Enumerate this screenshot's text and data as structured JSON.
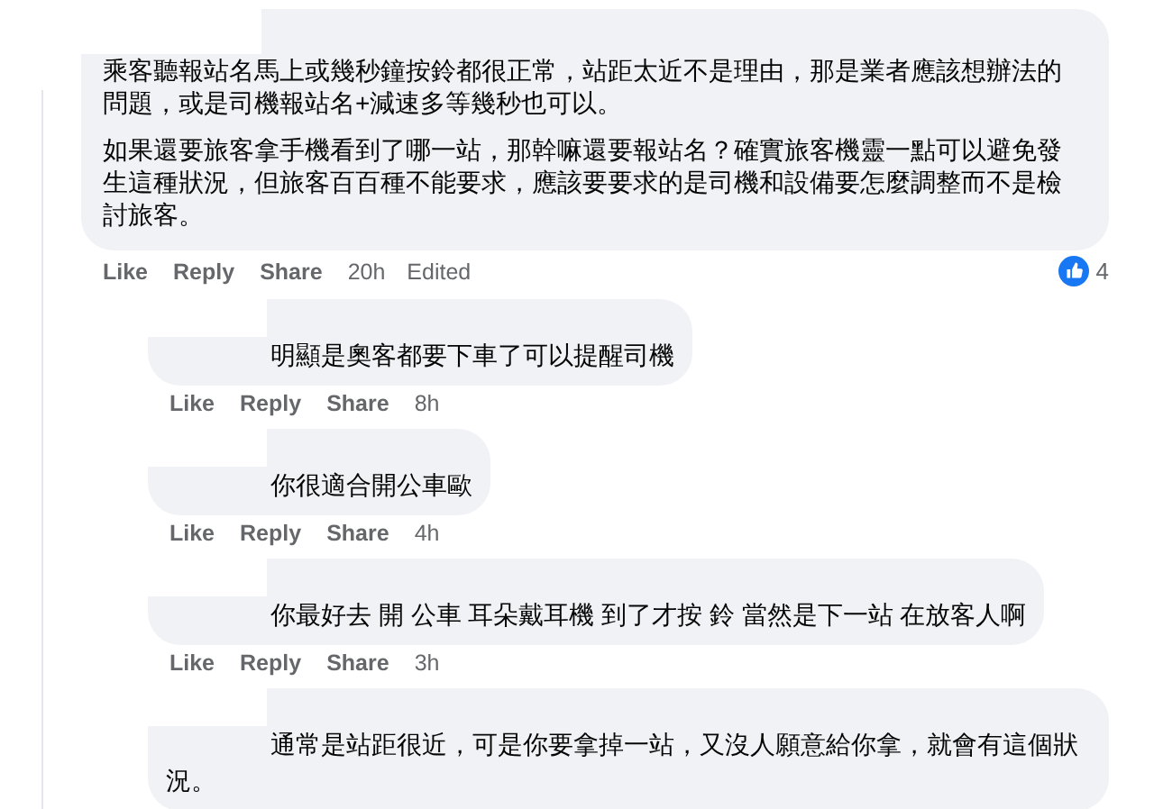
{
  "comment": {
    "paragraphs": [
      "乘客聽報站名馬上或幾秒鐘按鈴都很正常，站距太近不是理由，那是業者應該想辦法的問題，或是司機報站名+減速多等幾秒也可以。",
      "如果還要旅客拿手機看到了哪一站，那幹嘛還要報站名？確實旅客機靈一點可以避免發生這種狀況，但旅客百百種不能要求，應該要要求的是司機和設備要怎麼調整而不是檢討旅客。"
    ],
    "actions": [
      "Like",
      "Reply",
      "Share"
    ],
    "time": "20h",
    "edited": "Edited",
    "reaction_count": "4"
  },
  "replies": [
    {
      "text": "明顯是奧客都要下車了可以提醒司機",
      "actions": [
        "Like",
        "Reply",
        "Share"
      ],
      "time": "8h"
    },
    {
      "text": "你很適合開公車歐",
      "actions": [
        "Like",
        "Reply",
        "Share"
      ],
      "time": "4h"
    },
    {
      "text": "你最好去 開 公車 耳朵戴耳機 到了才按 鈴 當然是下一站 在放客人啊",
      "actions": [
        "Like",
        "Reply",
        "Share"
      ],
      "time": "3h"
    },
    {
      "text": "通常是站距很近，可是你要拿掉一站，又沒人願意給你拿，就會有這個狀況。"
    }
  ]
}
